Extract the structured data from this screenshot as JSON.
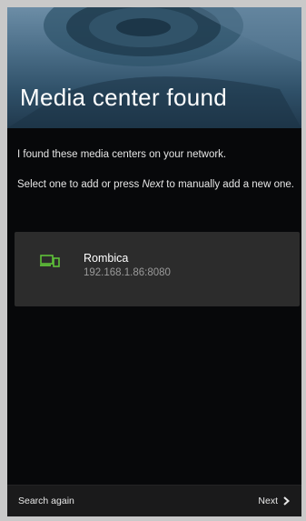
{
  "header": {
    "title": "Media center found"
  },
  "content": {
    "message_1": "I found these media centers on your network.",
    "message_2_prefix": "Select one to add or press ",
    "message_2_emphasis": "Next",
    "message_2_suffix": " to manually add a new one."
  },
  "media_centers": [
    {
      "name": "Rombica",
      "address": "192.168.1.86:8080",
      "icon": "devices-icon"
    }
  ],
  "footer": {
    "search_again_label": "Search again",
    "next_label": "Next"
  },
  "colors": {
    "accent_icon": "#5fc139",
    "card_background": "#2c2c2c",
    "screen_background": "#07080a",
    "header_background": "#3f6178"
  }
}
